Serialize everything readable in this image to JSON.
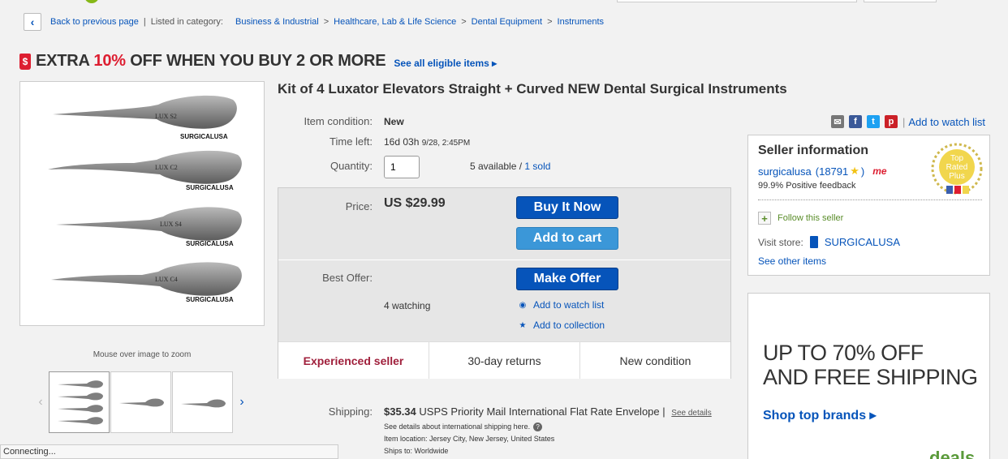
{
  "breadcrumb": {
    "back_label": "Back to previous page",
    "listed_in": "Listed in category:",
    "categories": [
      "Business & Industrial",
      "Healthcare, Lab & Life Science",
      "Dental Equipment",
      "Instruments"
    ]
  },
  "promo": {
    "icon": "price-tag-icon",
    "text_before": "EXTRA ",
    "percent": "10%",
    "text_after": " OFF WHEN YOU BUY 2 OR MORE",
    "link": "See all eligible items ▸"
  },
  "gallery": {
    "zoom_note": "Mouse over image to zoom",
    "brand": "SURGICALUSA",
    "instrument_labels": [
      "LUX S2",
      "LUX C2",
      "LUX S4",
      "LUX C4"
    ]
  },
  "item": {
    "title": "Kit of 4 Luxator Elevators Straight + Curved NEW Dental Surgical Instruments",
    "condition_label": "Item condition:",
    "condition": "New",
    "time_left_label": "Time left:",
    "time_left": "16d 03h",
    "time_left_date": "9/28, 2:45PM",
    "quantity_label": "Quantity:",
    "quantity": "1",
    "available": "5 available /",
    "sold": "1 sold",
    "price_label": "Price:",
    "price": "US $29.99",
    "buy_now": "Buy It Now",
    "add_to_cart": "Add to cart",
    "best_offer_label": "Best Offer:",
    "make_offer": "Make Offer",
    "watching": "4 watching",
    "add_watch": "Add to watch list",
    "add_collection": "Add to collection",
    "badges": [
      "Experienced seller",
      "30-day returns",
      "New condition"
    ]
  },
  "shipping": {
    "label": "Shipping:",
    "price": "$35.34",
    "method": "USPS Priority Mail International Flat Rate Envelope",
    "separator": "|",
    "see_details": "See details",
    "intl_note": "See details about international shipping here.",
    "location_label": "Item location:",
    "location": "Jersey City, New Jersey, United States",
    "ships_label": "Ships to:",
    "ships_to": "Worldwide"
  },
  "share": {
    "icons": [
      "email-icon",
      "facebook-icon",
      "twitter-icon",
      "pinterest-icon"
    ],
    "separator": "|",
    "watch_link": "Add to watch list"
  },
  "seller": {
    "title": "Seller information",
    "name": "surgicalusa",
    "feedback_open": "(18791",
    "feedback_close": ")",
    "me_badge": "me",
    "positive": "99.9% Positive feedback",
    "top_rated": [
      "Top",
      "Rated",
      "Plus"
    ],
    "follow": "Follow this seller",
    "visit_label": "Visit store:",
    "store": "SURGICALUSA",
    "other_items": "See other items"
  },
  "ad": {
    "line1_prefix": "UP TO ",
    "line1_value": "70% OFF",
    "line2": "AND FREE SHIPPING",
    "cta": "Shop top brands ▸",
    "logo": "deals"
  },
  "status_bar": "Connecting..."
}
